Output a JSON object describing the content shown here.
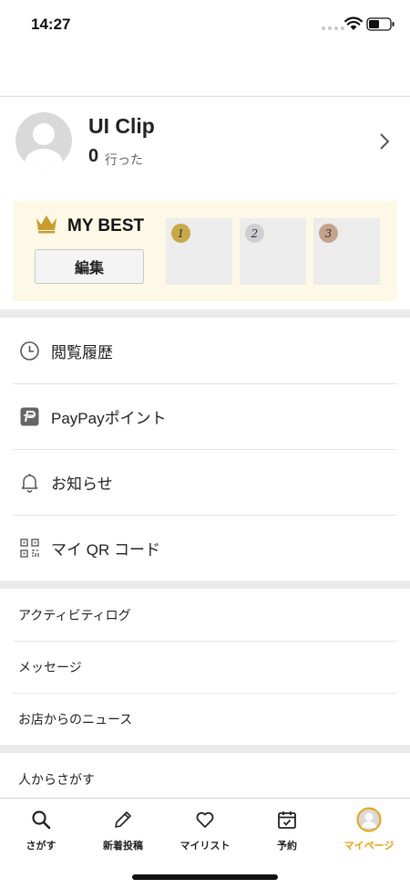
{
  "status": {
    "time": "14:27"
  },
  "profile": {
    "name": "UI Clip",
    "count": "0",
    "count_label": "行った"
  },
  "mybest": {
    "title": "MY BEST",
    "edit_label": "編集",
    "ranks": [
      "1",
      "2",
      "3"
    ],
    "colors": {
      "gold": "#c9a84a",
      "silver": "#cfcfd2",
      "bronze": "#c4a38a",
      "crown": "#c99b2c"
    }
  },
  "menu": {
    "items": [
      {
        "label": "閲覧履歴",
        "icon": "clock-icon"
      },
      {
        "label": "PayPayポイント",
        "icon": "paypay-icon"
      },
      {
        "label": "お知らせ",
        "icon": "bell-icon"
      },
      {
        "label": "マイ QR コード",
        "icon": "qr-code-icon"
      }
    ]
  },
  "links": {
    "items": [
      "アクティビティログ",
      "メッセージ",
      "お店からのニュース"
    ]
  },
  "more": {
    "items": [
      "人からさがす"
    ]
  },
  "tabbar": {
    "accent": "#e8a20c",
    "tabs": [
      {
        "label": "さがす",
        "icon": "search-icon"
      },
      {
        "label": "新着投稿",
        "icon": "pencil-icon"
      },
      {
        "label": "マイリスト",
        "icon": "heart-icon"
      },
      {
        "label": "予約",
        "icon": "calendar-icon"
      },
      {
        "label": "マイページ",
        "icon": "avatar-icon"
      }
    ]
  }
}
